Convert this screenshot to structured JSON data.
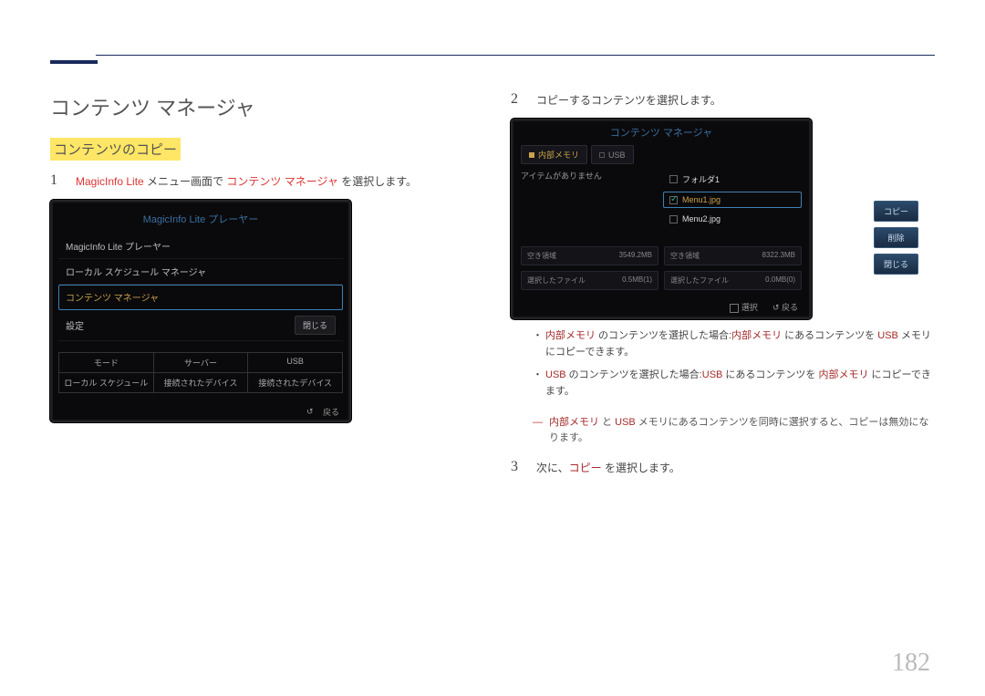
{
  "page_number": "182",
  "left": {
    "title": "コンテンツ マネージャ",
    "subhead": "コンテンツのコピー",
    "step1_num": "1",
    "step1_prefix": "MagicInfo Lite",
    "step1_mid": " メニュー画面で ",
    "step1_kw": "コンテンツ マネージャ",
    "step1_suffix": " を選択します。",
    "mock1": {
      "title": "MagicInfo Lite プレーヤー",
      "row1": "MagicInfo Lite プレーヤー",
      "row2": "ローカル スケジュール マネージャ",
      "row3": "コンテンツ マネージャ",
      "row4": "設定",
      "close": "閉じる",
      "tab1": "モード",
      "tab2": "サーバー",
      "tab3": "USB",
      "sub1": "ローカル スケジュール",
      "sub2": "接続されたデバイス",
      "sub3": "接続されたデバイス",
      "return": "戻る"
    }
  },
  "right": {
    "step2_num": "2",
    "step2_text": "コピーするコンテンツを選択します。",
    "mock2": {
      "title": "コンテンツ マネージャ",
      "tab_internal": "内部メモリ",
      "tab_usb": "USB",
      "left_empty": "アイテムがありません",
      "folder": "フォルダ1",
      "file1": "Menu1.jpg",
      "file2": "Menu2.jpg",
      "btn_copy": "コピー",
      "btn_delete": "削除",
      "btn_close": "閉じる",
      "free_label": "空き領域",
      "free_val1": "3549.2MB",
      "free_val2": "8322.3MB",
      "sel_label": "選択したファイル",
      "sel_val1": "0.5MB(1)",
      "sel_val2": "0.0MB(0)",
      "footer_select": "選択",
      "footer_return": "戻る"
    },
    "note1_kw1": "内部メモリ",
    "note1_mid": " のコンテンツを選択した場合:",
    "note1_kw2": "内部メモリ",
    "note1_mid2": " にあるコンテンツを ",
    "note1_kw3": "USB",
    "note1_suffix": " メモリにコピーできます。",
    "note2_kw1": "USB",
    "note2_mid": " のコンテンツを選択した場合:",
    "note2_kw2": "USB",
    "note2_mid2": " にあるコンテンツを ",
    "note2_kw3": "内部メモリ",
    "note2_suffix": " にコピーできます。",
    "dash_kw1": "内部メモリ",
    "dash_mid": " と ",
    "dash_kw2": "USB",
    "dash_suffix": " メモリにあるコンテンツを同時に選択すると、コピーは無効になります。",
    "step3_num": "3",
    "step3_prefix": "次に、",
    "step3_kw": "コピー",
    "step3_suffix": " を選択します。"
  }
}
